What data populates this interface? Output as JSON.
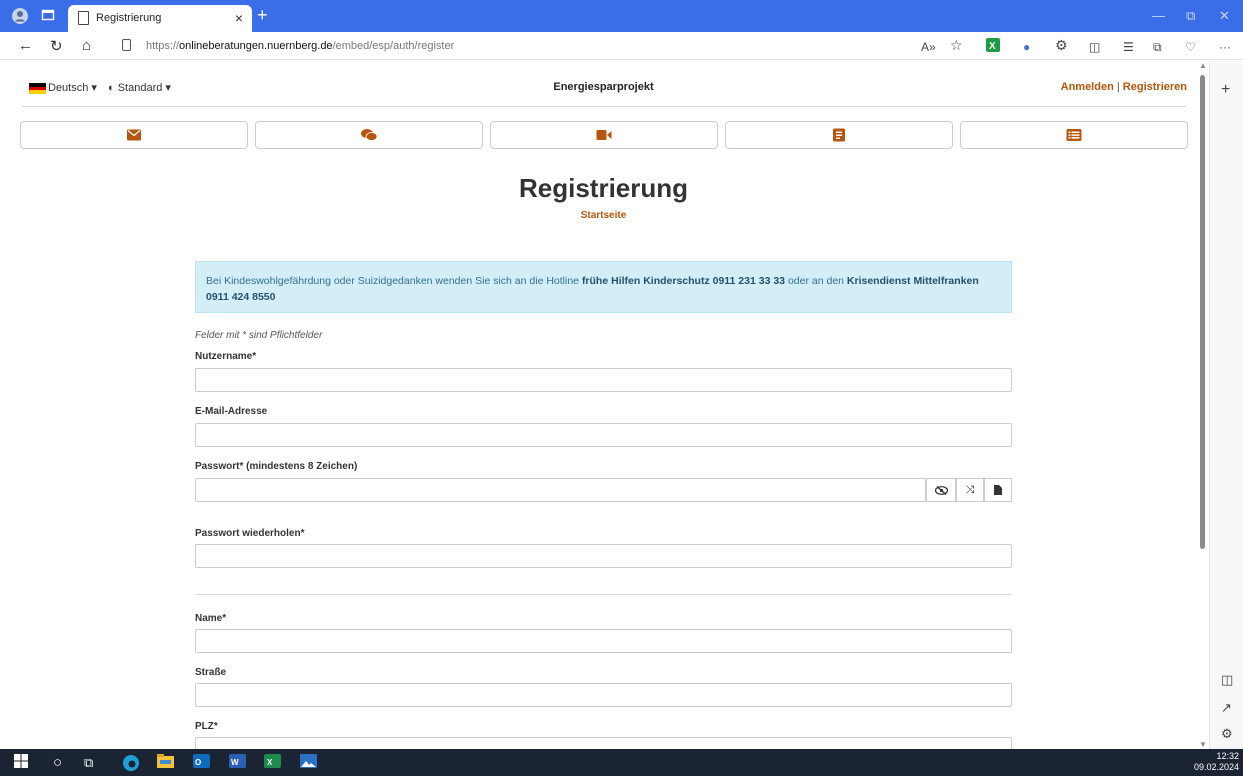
{
  "browser": {
    "tab_title": "Registrierung",
    "url_prefix": "https://",
    "url_host": "onlineberatungen.nuernberg.de",
    "url_path": "/embed/esp/auth/register",
    "accent_color": "#3a6ee8"
  },
  "header": {
    "language": "Deutsch",
    "contrast": "Standard",
    "brand": "Energiesparprojekt",
    "login_link": "Anmelden",
    "separator": "|",
    "register_link": "Registrieren"
  },
  "contact_buttons": [
    {
      "icon": "envelope-icon"
    },
    {
      "icon": "chat-icon"
    },
    {
      "icon": "video-icon"
    },
    {
      "icon": "form-icon"
    },
    {
      "icon": "list-icon"
    }
  ],
  "main": {
    "title": "Registrierung",
    "breadcrumb": "Startseite",
    "alert": {
      "text1": "Bei Kindeswohlgefährdung oder Suizidgedanken wenden Sie sich an die Hotline ",
      "hotline": "frühe Hilfen Kinderschutz 0911 231 33 33",
      "text2": " oder an den ",
      "crisis": "Krisendienst Mittelfranken 0911 424 8550"
    },
    "required_note": "Felder mit * sind Pflichtfelder",
    "labels": {
      "username": "Nutzername*",
      "email": "E-Mail-Adresse",
      "password": "Passwort* (mindestens 8 Zeichen)",
      "password_repeat": "Passwort wiederholen*",
      "name": "Name*",
      "street": "Straße",
      "zip": "PLZ*"
    }
  },
  "colors": {
    "link": "#b5560c",
    "alert_bg": "#d4eef7",
    "alert_text": "#31708f"
  },
  "taskbar": {
    "time": "12:32",
    "date": "09.02.2024"
  }
}
